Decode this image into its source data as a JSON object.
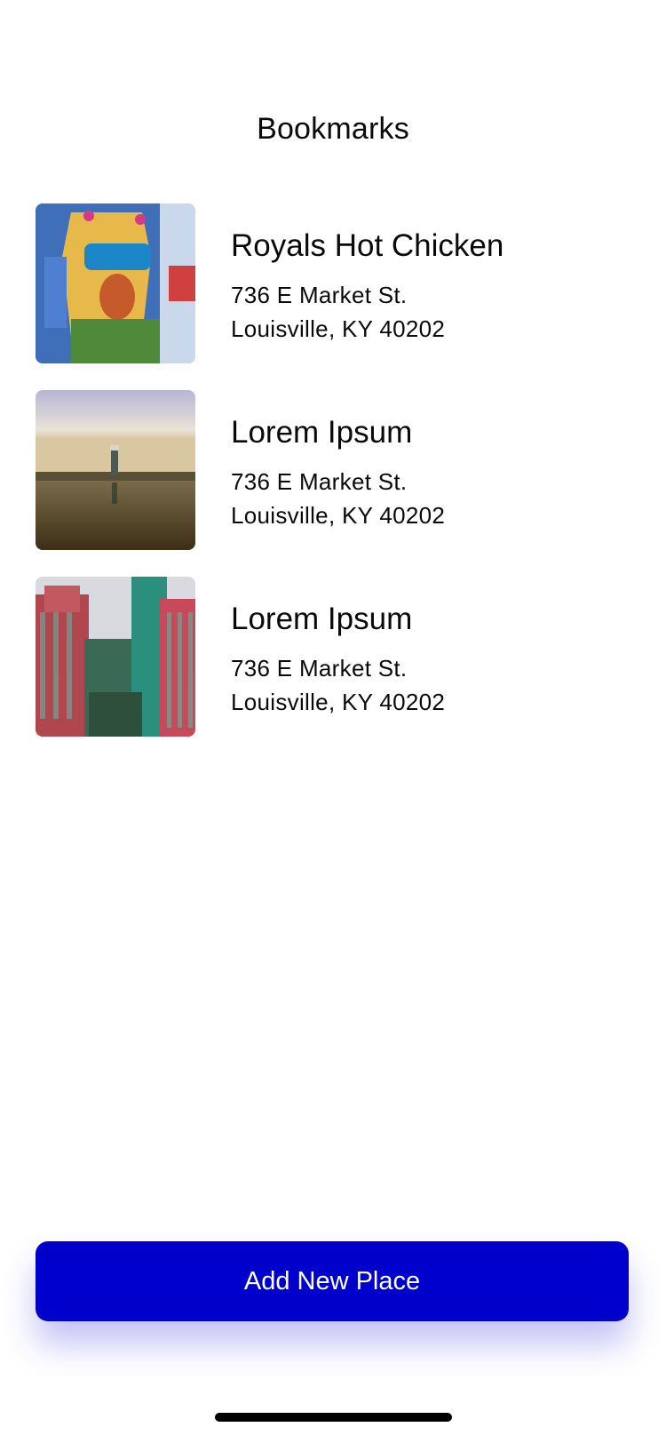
{
  "header": {
    "title": "Bookmarks"
  },
  "places": [
    {
      "name": "Royals Hot Chicken",
      "address_line1": "736 E Market St.",
      "address_line2": "Louisville, KY 40202",
      "thumbnail": "street-mural-photo"
    },
    {
      "name": "Lorem Ipsum",
      "address_line1": "736 E Market St.",
      "address_line2": "Louisville, KY 40202",
      "thumbnail": "lighthouse-photo"
    },
    {
      "name": "Lorem Ipsum",
      "address_line1": "736 E Market St.",
      "address_line2": "Louisville, KY 40202",
      "thumbnail": "city-buildings-photo"
    }
  ],
  "footer": {
    "add_button_label": "Add New Place"
  },
  "colors": {
    "accent": "#0000cc",
    "background": "#ffffff",
    "text": "#0a0a0a"
  }
}
